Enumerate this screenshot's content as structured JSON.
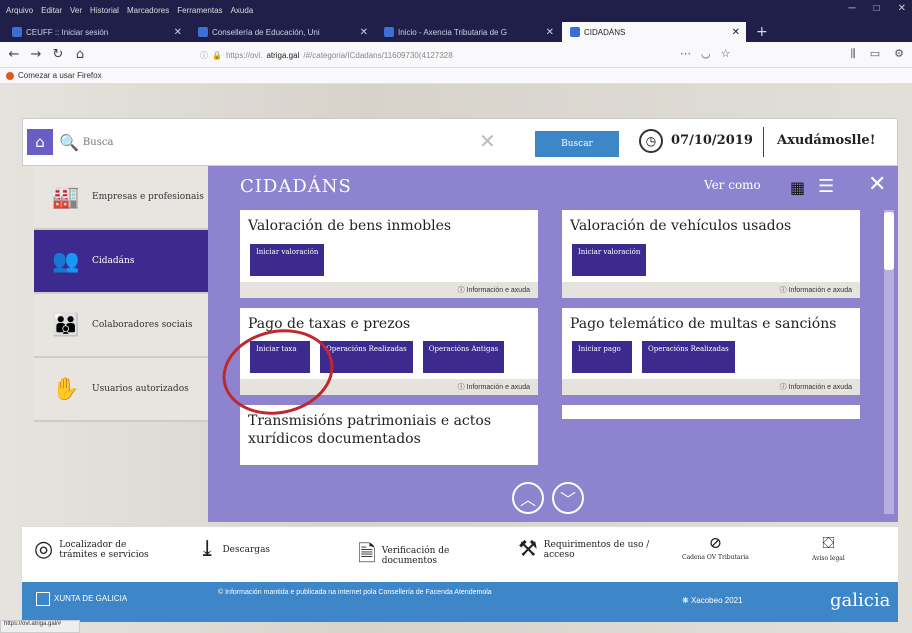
{
  "menubar": {
    "items": [
      "Arquivo",
      "Editar",
      "Ver",
      "Historial",
      "Marcadores",
      "Ferramentas",
      "Axuda"
    ]
  },
  "tabs": [
    {
      "label": "CEUFF :: Iniciar sesión"
    },
    {
      "label": "Consellería de Educación, Uni"
    },
    {
      "label": "Inicio - Axencia Tributaria de G"
    },
    {
      "label": "CIDADÁNS"
    }
  ],
  "nav": {
    "url_prefix": "https://ovl.",
    "url_host": "atriga.gal",
    "url_rest": "/#/categoria/ICdadans/11609730(4127328"
  },
  "bookmarks": {
    "label": "Comezar a usar Firefox"
  },
  "header": {
    "search_placeholder": "Busca",
    "search_button": "Buscar",
    "date": "07/10/2019",
    "welcome": "Axudámoslle!"
  },
  "sidebar": [
    {
      "label": "Empresas e profesionais",
      "icon": "factory-icon"
    },
    {
      "label": "Cidadáns",
      "icon": "people-icon"
    },
    {
      "label": "Colaboradores sociais",
      "icon": "collaborators-icon"
    },
    {
      "label": "Usuarios autorizados",
      "icon": "authorized-users-icon"
    }
  ],
  "main": {
    "title": "CIDADÁNS",
    "ver_como": "Ver como",
    "col_left": [
      {
        "title": "Valoración de bens inmobles",
        "buttons": [
          "Iniciar valoración"
        ],
        "info": "Información e axuda"
      },
      {
        "title": "Pago de taxas e prezos",
        "buttons": [
          "Iniciar taxa",
          "Operacións Realizadas",
          "Operacións Antigas"
        ],
        "info": "Información e axuda"
      },
      {
        "title": "Transmisións patrimoniais e actos xurídicos documentados",
        "buttons": [],
        "info": ""
      }
    ],
    "col_right": [
      {
        "title": "Valoración de vehículos usados",
        "buttons": [
          "Iniciar valoración"
        ],
        "info": "Información e axuda"
      },
      {
        "title": "Pago telemático de multas e sancións",
        "buttons": [
          "Iniciar pago",
          "Operacións Realizadas"
        ],
        "info": "Información e axuda"
      },
      {
        "title": "",
        "buttons": [],
        "info": ""
      }
    ]
  },
  "footer": {
    "localizador": "Localizador de trámites e servicios",
    "descargas": "Descargas",
    "verificacion": "Verificación de documentos",
    "requirimentos": "Requirimentos de uso / acceso",
    "cadena": "Cadena OV Tributaria",
    "aviso": "Aviso legal"
  },
  "bottombar": {
    "xunta": "XUNTA DE GALICIA",
    "info": "© Información mantida e publicada na internet pola Consellería de Facenda Atendemola",
    "xacobeo": "Xacobeo 2021",
    "galicia": "galicia"
  },
  "status": {
    "url": "https://ovl.atriga.gal/#"
  }
}
